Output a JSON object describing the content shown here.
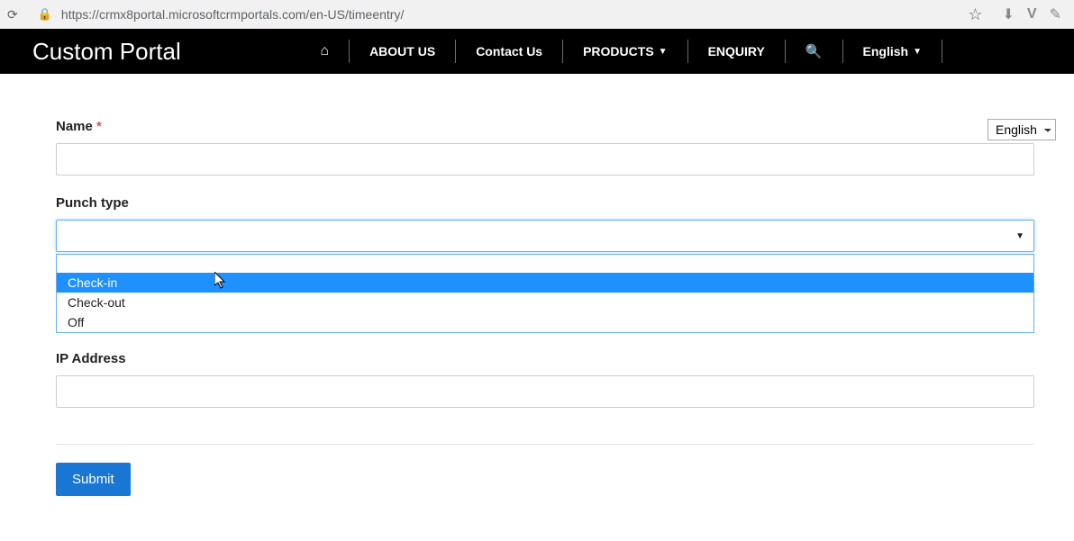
{
  "browser": {
    "url": "https://crmx8portal.microsoftcrmportals.com/en-US/timeentry/"
  },
  "header": {
    "brand": "Custom Portal",
    "nav": {
      "about": "ABOUT US",
      "contact": "Contact Us",
      "products": "PRODUCTS",
      "enquiry": "ENQUIRY",
      "language": "English"
    }
  },
  "page": {
    "langSelector": "English",
    "form": {
      "nameLabel": "Name",
      "requiredMark": "*",
      "nameValue": "",
      "punchTypeLabel": "Punch type",
      "punchTypeSelected": "",
      "punchOptions": {
        "opt1": "Check-in",
        "opt2": "Check-out",
        "opt3": "Off"
      },
      "ipLabel": "IP Address",
      "ipValue": "",
      "submit": "Submit"
    }
  }
}
